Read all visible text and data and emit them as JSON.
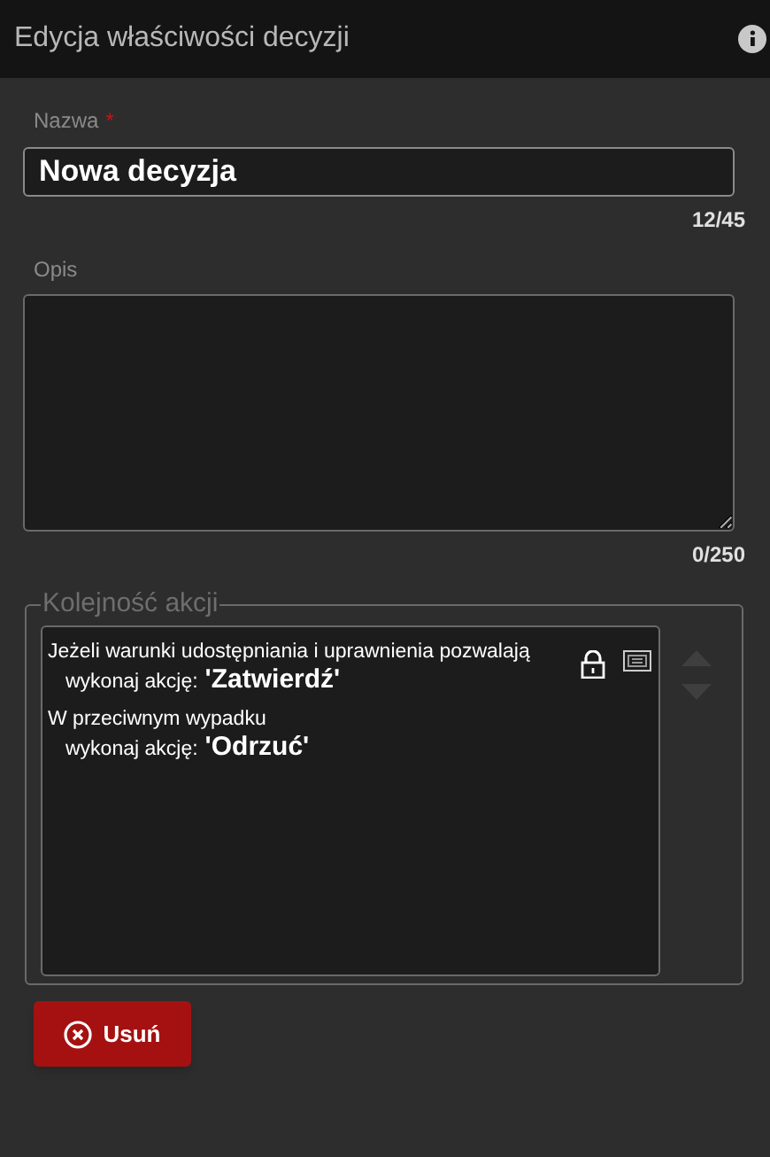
{
  "window": {
    "title": "Edycja właściwości decyzji"
  },
  "name_field": {
    "label": "Nazwa",
    "required_mark": "*",
    "value": "Nowa decyzja",
    "counter": "12/45"
  },
  "description_field": {
    "label": "Opis",
    "counter": "0/250"
  },
  "action_order": {
    "legend": "Kolejność akcji",
    "rules": [
      {
        "condition": "Jeżeli warunki udostępniania i uprawnienia pozwalają",
        "prefix": "wykonaj akcję:",
        "action": "'Zatwierdź'",
        "locked": true,
        "details": true
      },
      {
        "condition": "W przeciwnym wypadku",
        "prefix": "wykonaj akcję:",
        "action": "'Odrzuć'",
        "locked": false,
        "details": false
      }
    ]
  },
  "buttons": [
    {
      "label": "Usuń"
    }
  ]
}
